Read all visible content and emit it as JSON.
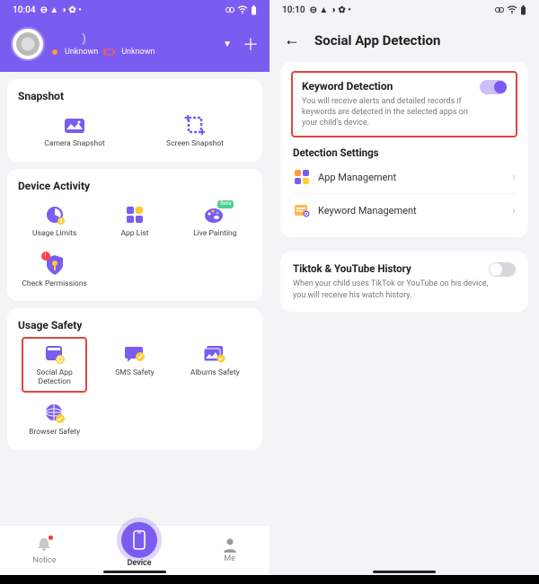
{
  "left": {
    "status": {
      "time": "10:04",
      "icons": "⊕ ▲ ✈ ✿ •",
      "right": "⌬ ♡ ▮"
    },
    "profile": {
      "name_placeholder": ")",
      "unknown_left": "Unknown",
      "unknown_right": "Unknown"
    },
    "snapshot": {
      "title": "Snapshot",
      "items": [
        {
          "key": "camera-snapshot",
          "label": "Camera Snapshot"
        },
        {
          "key": "screen-snapshot",
          "label": "Screen Snapshot"
        }
      ]
    },
    "device_activity": {
      "title": "Device Activity",
      "items": [
        {
          "key": "usage-limits",
          "label": "Usage Limits"
        },
        {
          "key": "app-list",
          "label": "App List"
        },
        {
          "key": "live-painting",
          "label": "Live Painting",
          "badge": "Beta"
        },
        {
          "key": "check-permissions",
          "label": "Check Permissions",
          "alert": true
        }
      ]
    },
    "usage_safety": {
      "title": "Usage Safety",
      "items": [
        {
          "key": "social-app-detection",
          "label": "Social App\nDetection",
          "highlighted": true
        },
        {
          "key": "sms-safety",
          "label": "SMS Safety"
        },
        {
          "key": "albums-safety",
          "label": "Albums Safety"
        },
        {
          "key": "browser-safety",
          "label": "Browser Safety"
        }
      ]
    },
    "bottom_nav": {
      "items": [
        {
          "key": "notice",
          "label": "Notice",
          "badge": true
        },
        {
          "key": "device",
          "label": "Device",
          "active": true
        },
        {
          "key": "me",
          "label": "Me"
        }
      ]
    }
  },
  "right": {
    "status": {
      "time": "10:10",
      "icons": "⊕ ▲ ✈ ✿ •",
      "right": "⌬ ♡ ▮"
    },
    "title": "Social App Detection",
    "keyword": {
      "title": "Keyword Detection",
      "desc": "You will receive alerts and detailed records if keywords are detected in the selected apps on your child's device.",
      "toggle": true
    },
    "settings": {
      "title": "Detection Settings",
      "rows": [
        {
          "key": "app-management",
          "label": "App Management"
        },
        {
          "key": "keyword-management",
          "label": "Keyword Management"
        }
      ]
    },
    "tiktok": {
      "title": "Tiktok & YouTube History",
      "desc": "When your child uses TikTok or YouTube on his device, you will receive his watch history.",
      "toggle": false
    }
  }
}
